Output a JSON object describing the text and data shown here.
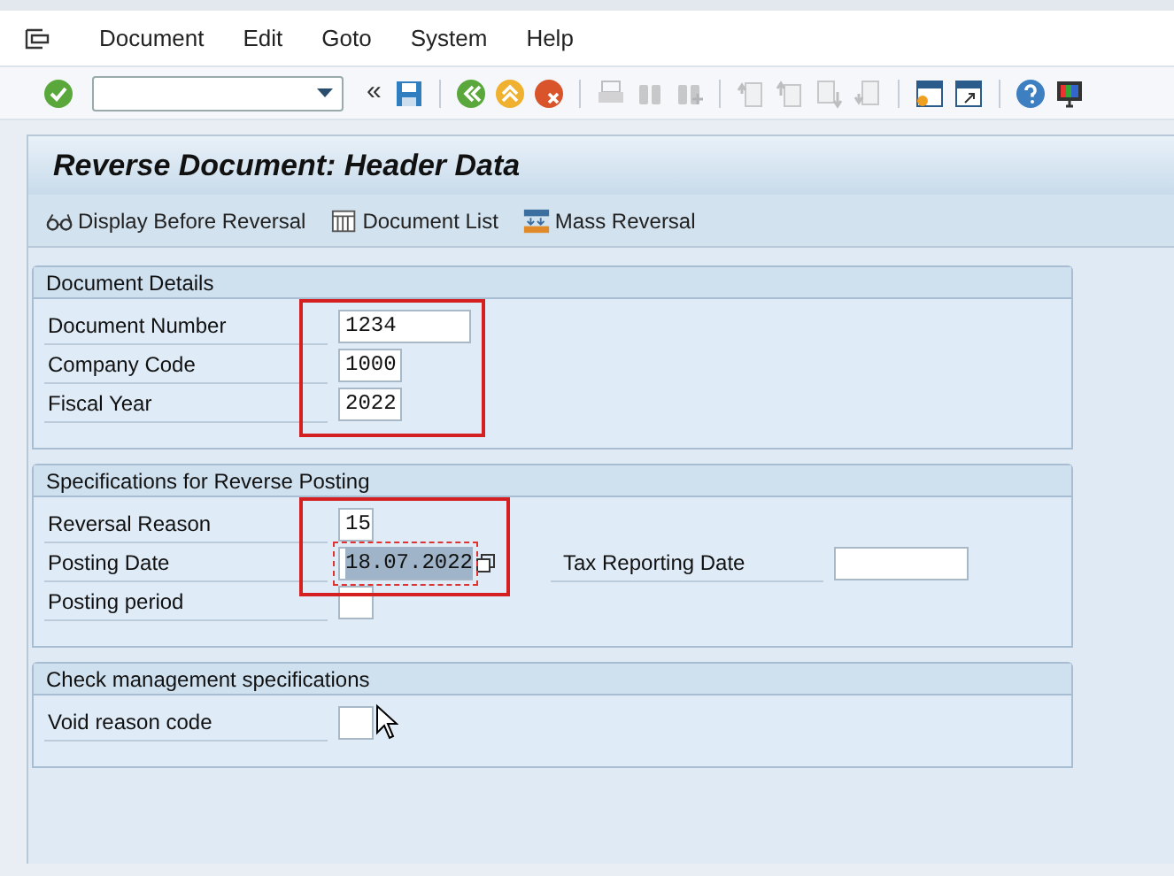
{
  "menu": [
    {
      "label": "Document"
    },
    {
      "label": "Edit"
    },
    {
      "label": "Goto"
    },
    {
      "label": "System"
    },
    {
      "label": "Help"
    }
  ],
  "toolbar": [
    {
      "kind": "enter",
      "disabled": false
    },
    {
      "kind": "command",
      "disabled": false
    },
    {
      "kind": "collapse",
      "glyph": "«",
      "disabled": false
    },
    {
      "kind": "save",
      "disabled": false
    },
    {
      "kind": "separator"
    },
    {
      "kind": "back",
      "disabled": false
    },
    {
      "kind": "exit",
      "disabled": false
    },
    {
      "kind": "cancel",
      "disabled": false
    },
    {
      "kind": "separator"
    },
    {
      "kind": "print",
      "disabled": true
    },
    {
      "kind": "find",
      "disabled": true
    },
    {
      "kind": "find_next",
      "disabled": true
    },
    {
      "kind": "separator"
    },
    {
      "kind": "first",
      "disabled": true
    },
    {
      "kind": "prev",
      "disabled": true
    },
    {
      "kind": "next",
      "disabled": true
    },
    {
      "kind": "last",
      "disabled": true
    },
    {
      "kind": "separator"
    },
    {
      "kind": "new_session",
      "disabled": false
    },
    {
      "kind": "shortcut",
      "disabled": false
    },
    {
      "kind": "separator"
    },
    {
      "kind": "help",
      "disabled": false
    },
    {
      "kind": "layout",
      "disabled": false
    }
  ],
  "title": "Reverse Document: Header Data",
  "app_toolbar": [
    {
      "kind": "glasses",
      "label": "Display Before Reversal"
    },
    {
      "kind": "list",
      "label": "Document List"
    },
    {
      "kind": "mass",
      "label": "Mass Reversal"
    }
  ],
  "groups": [
    {
      "title": "Document Details",
      "rows": [
        {
          "label": "Document Number",
          "value": "1234",
          "kind": "long",
          "highlighted": true,
          "focused": false
        },
        {
          "label": "Company Code",
          "value": "1000",
          "kind": "code",
          "highlighted": true,
          "focused": false
        },
        {
          "label": "Fiscal Year",
          "value": "2022",
          "kind": "code",
          "highlighted": true,
          "focused": false
        }
      ]
    },
    {
      "title": "Specifications for Reverse Posting",
      "rows": [
        {
          "label": "Reversal Reason",
          "value": "15",
          "kind": "tiny",
          "highlighted": true,
          "focused": false
        },
        {
          "label": "Posting Date",
          "value": "18.07.2022",
          "kind": "date",
          "highlighted": true,
          "focused": true,
          "extra": {
            "label": "Tax Reporting Date",
            "kind": "date"
          }
        },
        {
          "label": "Posting period",
          "kind": "tiny",
          "highlighted": false,
          "focused": false
        }
      ]
    },
    {
      "title": "Check management specifications",
      "rows": [
        {
          "label": "Void reason code",
          "kind": "tiny",
          "highlighted": false,
          "focused": false
        }
      ]
    }
  ]
}
